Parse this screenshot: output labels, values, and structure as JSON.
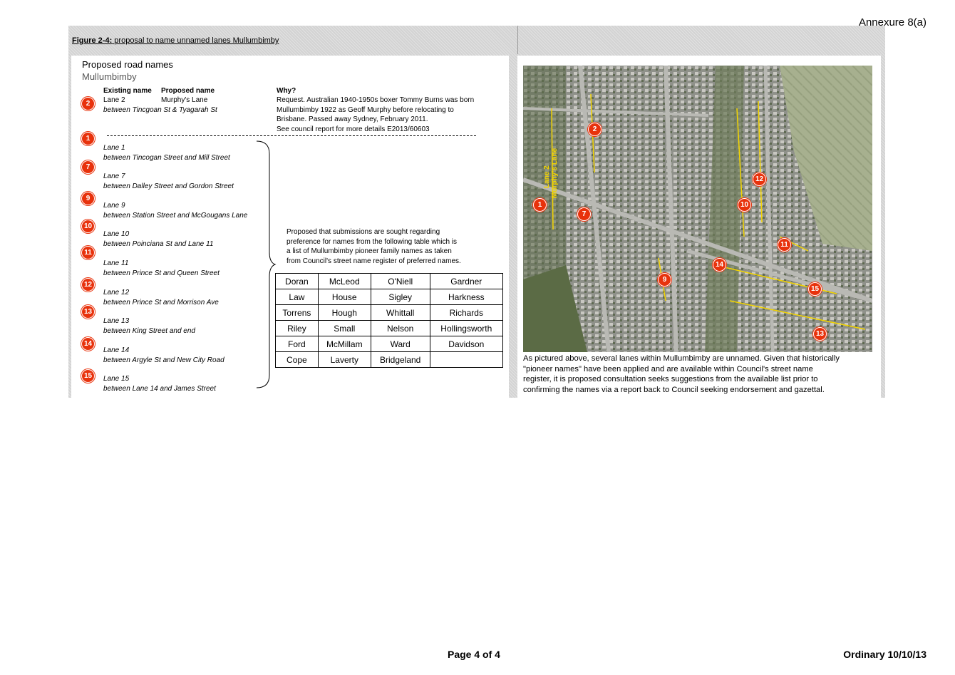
{
  "header": {
    "annexure": "Annexure 8(a)"
  },
  "figure": {
    "caption_bold": "Figure 2-4:",
    "caption_rest": "proposal to name unnamed lanes Mullumbimby"
  },
  "left": {
    "title": "Proposed road names",
    "subtitle": "Mullumbimby",
    "headers": {
      "existing": "Existing name",
      "proposed": "Proposed name",
      "why": "Why?"
    },
    "lane2": {
      "marker": "2",
      "existing": "Lane 2",
      "proposed": "Murphy's Lane",
      "between": "between Tincgoan St & Tyagarah St",
      "why": [
        "Request. Australian 1940-1950s boxer Tommy Burns was born",
        "Mullumbimby 1922 as Geoff Murphy before relocating to",
        "Brisbane. Passed away Sydney, February 2011.",
        "See council report for more details E2013/60603"
      ]
    },
    "lanes": [
      {
        "marker": "1",
        "name": "Lane 1",
        "between": "between Tincogan Street and Mill Street"
      },
      {
        "marker": "7",
        "name": "Lane 7",
        "between": "between Dalley Street and Gordon Street"
      },
      {
        "marker": "9",
        "name": "Lane 9",
        "between": "between Station Street and McGougans Lane"
      },
      {
        "marker": "10",
        "name": "Lane 10",
        "between": "between Poinciana St and Lane 11"
      },
      {
        "marker": "11",
        "name": "Lane 11",
        "between": "between Prince St and Queen Street"
      },
      {
        "marker": "12",
        "name": "Lane 12",
        "between": "between Prince St and Morrison Ave"
      },
      {
        "marker": "13",
        "name": "Lane 13",
        "between": "between King Street and end"
      },
      {
        "marker": "14",
        "name": "Lane 14",
        "between": "between Argyle St and New City Road"
      },
      {
        "marker": "15",
        "name": "Lane 15",
        "between": "between Lane 14 and James Street"
      }
    ],
    "note": [
      "Proposed that submissions are sought regarding",
      "preference for names from the following table which is",
      "a list of Mullumbimby pioneer family names as taken",
      "from Council's street name register of preferred names."
    ],
    "names_table": [
      [
        "Doran",
        "McLeod",
        "O'Niell",
        "Gardner"
      ],
      [
        "Law",
        "House",
        "Sigley",
        "Harkness"
      ],
      [
        "Torrens",
        "Hough",
        "Whittall",
        "Richards"
      ],
      [
        "Riley",
        "Small",
        "Nelson",
        "Hollingsworth"
      ],
      [
        "Ford",
        "McMillam",
        "Ward",
        "Davidson"
      ],
      [
        "Cope",
        "Laverty",
        "Bridgeland",
        ""
      ]
    ]
  },
  "right": {
    "map_markers": [
      "1",
      "2",
      "7",
      "9",
      "10",
      "11",
      "12",
      "13",
      "14",
      "15"
    ],
    "map_labels": [
      "Lane 2",
      "Murphy's Lane"
    ],
    "caption": [
      "As pictured above, several lanes within Mullumbimby are unnamed. Given that historically",
      "\"pioneer names\" have been applied and are available within Council's street name",
      "register, it is proposed consultation seeks suggestions from the available list prior to",
      "confirming the names via a report back to Council seeking endorsement and gazettal."
    ]
  },
  "footer": {
    "page": "Page 4 of 4",
    "meeting": "Ordinary 10/10/13"
  },
  "colors": {
    "marker": "#e8320c",
    "lane_line": "#f3d400",
    "frame": "#d3d3d3"
  }
}
